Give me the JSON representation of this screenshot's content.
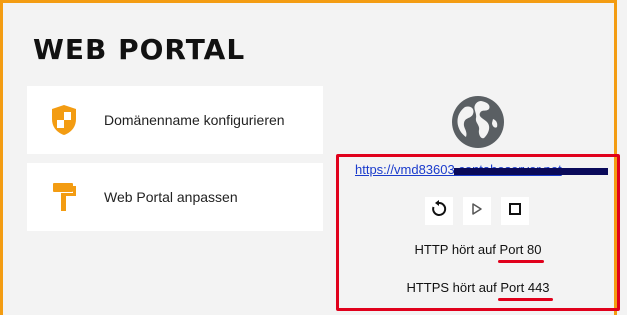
{
  "header": {
    "title": "WEB PORTAL"
  },
  "cards": [
    {
      "label": "Domänenname konfigurieren",
      "icon": "shield-icon"
    },
    {
      "label": "Web Portal anpassen",
      "icon": "paint-roller-icon"
    }
  ],
  "portal": {
    "url": "https://vmd83603.contaboserver.net",
    "buttons": [
      {
        "icon": "restart-icon"
      },
      {
        "icon": "play-icon"
      },
      {
        "icon": "stop-icon"
      }
    ],
    "http_prefix": "HTTP hört auf",
    "http_port": "Port 80",
    "https_prefix": "HTTPS hört auf",
    "https_port": "Port 443"
  },
  "colors": {
    "accent": "#f39c12",
    "highlight": "#e0001b",
    "link": "#1a3bcc"
  }
}
